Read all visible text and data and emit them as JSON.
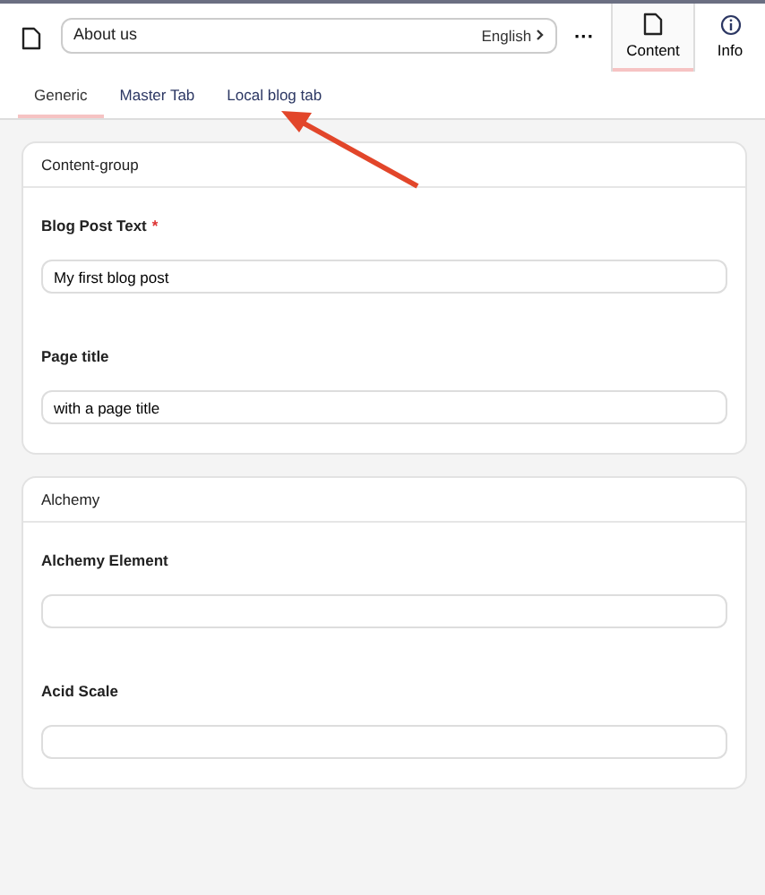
{
  "topbar": {
    "page_name": "About us",
    "language": "English",
    "more": "···"
  },
  "side_tabs": [
    {
      "label": "Content",
      "kind": "document",
      "selected": true
    },
    {
      "label": "Info",
      "kind": "info",
      "selected": false
    }
  ],
  "tabs": [
    {
      "label": "Generic",
      "selected": true
    },
    {
      "label": "Master Tab",
      "selected": false
    },
    {
      "label": "Local blog tab",
      "selected": false
    }
  ],
  "groups": [
    {
      "title": "Content-group",
      "fields": [
        {
          "label": "Blog Post Text",
          "required_mark": "*",
          "value": "My first blog post"
        },
        {
          "label": "Page title",
          "value": "with a page title"
        }
      ]
    },
    {
      "title": "Alchemy",
      "fields": [
        {
          "label": "Alchemy Element"
        },
        {
          "label": "Acid Scale"
        }
      ]
    }
  ],
  "annotation": {
    "kind": "arrow"
  }
}
